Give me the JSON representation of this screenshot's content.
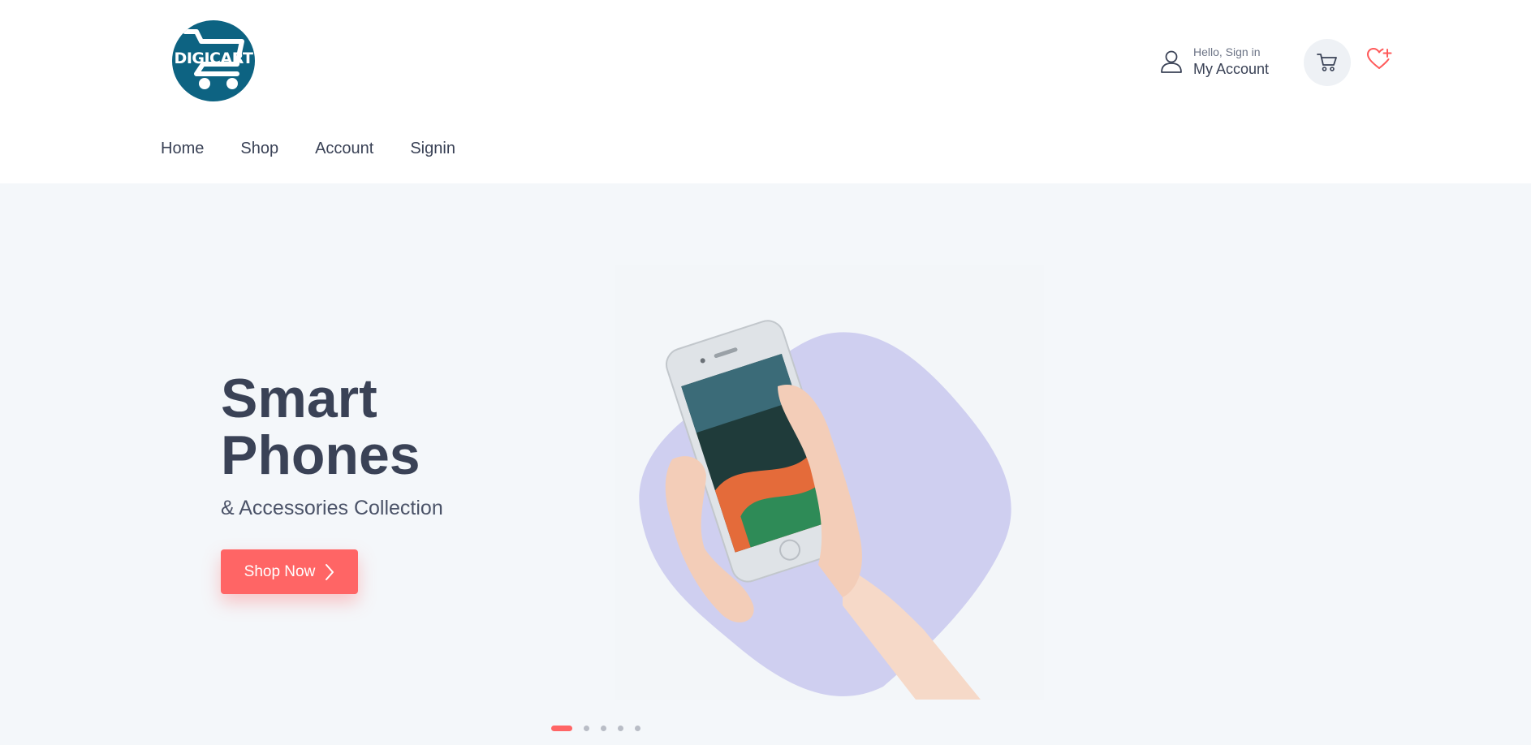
{
  "brand": {
    "logo_text": "DIGICART",
    "color": "#0d6382"
  },
  "account": {
    "greeting": "Hello, Sign in",
    "label": "My Account"
  },
  "icons": {
    "account": "user-icon",
    "cart": "cart-icon",
    "wishlist": "heart-plus-icon",
    "cta": "chevron-right-icon"
  },
  "nav": {
    "items": [
      {
        "label": "Home"
      },
      {
        "label": "Shop"
      },
      {
        "label": "Account"
      },
      {
        "label": "Signin"
      }
    ]
  },
  "hero": {
    "title_line1": "Smart",
    "title_line2": "Phones",
    "subtitle": "& Accessories Collection",
    "cta_label": "Shop Now",
    "blob_color": "#cfcff0",
    "accent": "#ff6565"
  },
  "carousel": {
    "slide_count": 5,
    "active_index": 0
  }
}
